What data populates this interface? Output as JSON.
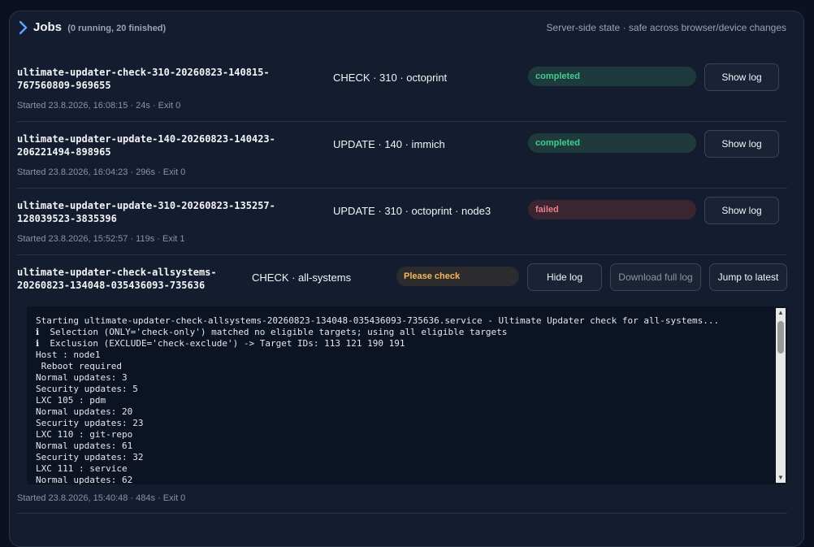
{
  "header": {
    "title": "Jobs",
    "summary": "(0 running, 20 finished)",
    "state_note": "Server-side state · safe across browser/device changes"
  },
  "jobs": [
    {
      "id": "ultimate-updater-check-310-20260823-140815-\n767560809-969655",
      "desc": "CHECK · 310 · octoprint",
      "status": "completed",
      "button": "Show log",
      "meta": "Started 23.8.2026, 16:08:15 · 24s · Exit 0"
    },
    {
      "id": "ultimate-updater-update-140-20260823-140423-\n206221494-898965",
      "desc": "UPDATE · 140 · immich",
      "status": "completed",
      "button": "Show log",
      "meta": "Started 23.8.2026, 16:04:23 · 296s · Exit 0"
    },
    {
      "id": "ultimate-updater-update-310-20260823-135257-\n128039523-3835396",
      "desc": "UPDATE · 310 · octoprint · node3",
      "status": "failed",
      "button": "Show log",
      "meta": "Started 23.8.2026, 15:52:57 · 119s · Exit 1"
    },
    {
      "id": "ultimate-updater-check-allsystems-\n20260823-134048-035436093-735636",
      "desc": "CHECK · all-systems",
      "status": "Please check",
      "buttons": {
        "hide": "Hide log",
        "download": "Download full log",
        "jump": "Jump to latest"
      },
      "meta": "Started 23.8.2026, 15:40:48 · 484s · Exit 0",
      "log": [
        "Starting ultimate-updater-check-allsystems-20260823-134048-035436093-735636.service - Ultimate Updater check for all-systems...",
        "ℹ  Selection (ONLY='check-only') matched no eligible targets; using all eligible targets",
        "ℹ  Exclusion (EXCLUDE='check-exclude') -> Target IDs: 113 121 190 191",
        "Host : node1",
        " Reboot required",
        "Normal updates: 3",
        "Security updates: 5",
        "LXC 105 : pdm",
        "Normal updates: 20",
        "Security updates: 23",
        "LXC 110 : git-repo",
        "Normal updates: 61",
        "Security updates: 32",
        "LXC 111 : service",
        "Normal updates: 62"
      ]
    }
  ],
  "colors": {
    "completed": "#3ecf8e",
    "failed": "#f47c8c",
    "warning": "#f7b955",
    "accent": "#60a5fa"
  }
}
